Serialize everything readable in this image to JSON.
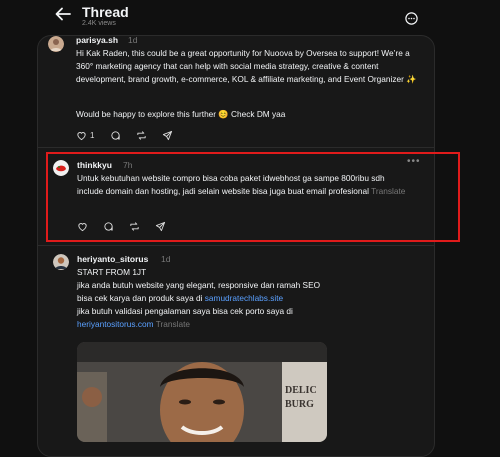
{
  "header": {
    "title": "Thread",
    "views": "2.4K views"
  },
  "posts": [
    {
      "username": "parisya.sh",
      "time": "1d",
      "text": "Hi Kak Raden, this could be a great opportunity for Nuoova by Oversea to support! We’re a 360° marketing agency that can help with social media strategy, creative & content development, brand growth, e-commerce, KOL & affiliate marketing, and Event Organizer ✨",
      "text2": "Would be happy to explore this further 😊 Check DM yaa",
      "like_count": "1"
    },
    {
      "username": "thinkkyu",
      "time": "7h",
      "text": "Untuk kebutuhan website compro bisa coba paket idwebhost ga sampe 800ribu sdh include domain dan hosting, jadi selain website bisa juga buat email profesional",
      "translate": "Translate"
    },
    {
      "username": "heriyanto_sitorus",
      "time": "1d",
      "line1": "START FROM 1JT",
      "line2": "jika anda butuh website yang elegant, responsive dan ramah SEO",
      "line3a": "bisa cek karya dan produk saya di ",
      "link1": "samudratechlabs.site",
      "line4": "jika butuh validasi pengalaman saya bisa cek porto saya di",
      "link2": "heriyantositorus.com",
      "translate": "Translate",
      "photo_sign": "DELIC BURG"
    }
  ],
  "colors": {
    "background": "#101010",
    "panel": "#181818",
    "link": "#5aa0ff",
    "highlight": "#e01b1b"
  }
}
